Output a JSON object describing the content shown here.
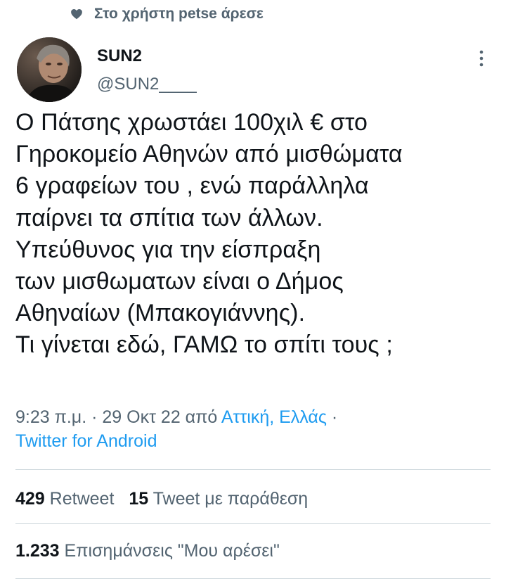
{
  "social_context": {
    "text": "Στο χρήστη petse άρεσε",
    "icon": "heart-icon"
  },
  "author": {
    "display_name": "SUN2",
    "handle": "@SUN2____"
  },
  "tweet": {
    "lines": [
      "Ο Πάτσης χρωστάει 100χιλ € στο",
      "Γηροκομείο Αθηνών από μισθώματα",
      "6 γραφείων του , ενώ παράλληλα",
      "παίρνει τα σπίτια των άλλων.",
      "Υπεύθυνος για την είσπραξη",
      "των μισθωματων είναι ο Δήμος",
      "Αθηναίων (Μπακογιάννης).",
      "Τι γίνεται εδώ, ΓΑΜΩ το σπίτι τους ;"
    ]
  },
  "meta": {
    "time": "9:23 π.μ.",
    "separator": "·",
    "date": "29 Οκτ 22",
    "from_text": "από",
    "location": "Αττική, Ελλάς",
    "separator_end": "·",
    "source": "Twitter for Android"
  },
  "stats": {
    "retweets_count": "429",
    "retweets_label": "Retweet",
    "quotes_count": "15",
    "quotes_label": "Tweet με παράθεση",
    "likes_count": "1.233",
    "likes_label": "Επισημάνσεις \"Μου αρέσει\""
  },
  "colors": {
    "text": "#0f1419",
    "secondary": "#536471",
    "link": "#1d9bf0",
    "divider": "#cfd9de"
  }
}
